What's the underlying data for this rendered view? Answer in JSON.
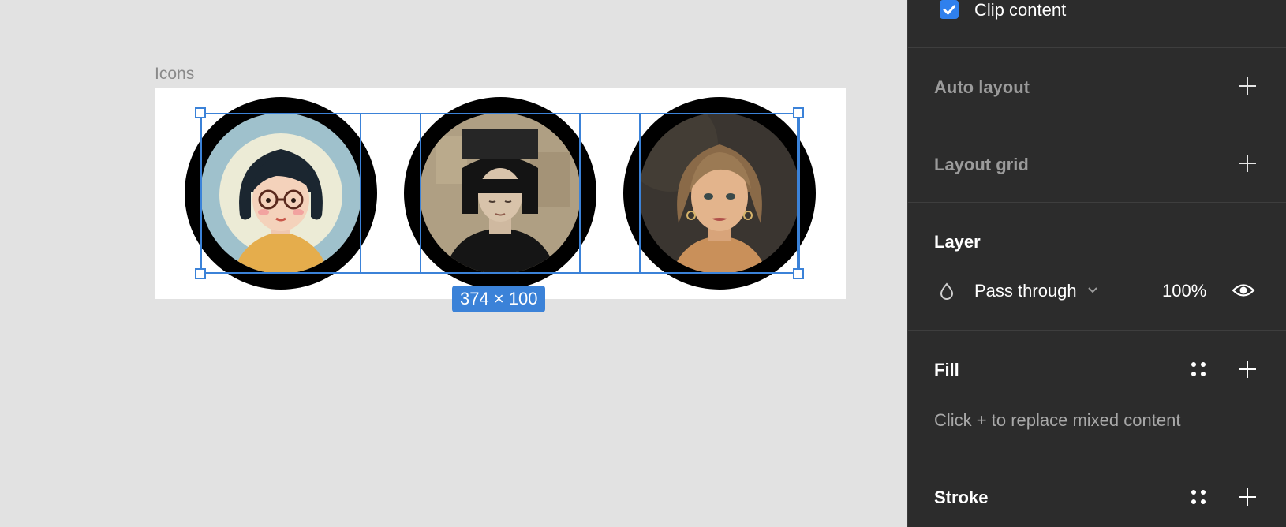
{
  "canvas": {
    "frame_label": "Icons",
    "size_badge": "374 × 100"
  },
  "panel": {
    "clip_content": {
      "label": "Clip content",
      "checked": true
    },
    "auto_layout": {
      "title": "Auto layout"
    },
    "layout_grid": {
      "title": "Layout grid"
    },
    "layer": {
      "title": "Layer",
      "blend_mode": "Pass through",
      "opacity": "100%"
    },
    "fill": {
      "title": "Fill",
      "message": "Click + to replace mixed content"
    },
    "stroke": {
      "title": "Stroke"
    }
  },
  "colors": {
    "selection": "#3b82d8",
    "checkbox": "#2f80ed",
    "panel_bg": "#2c2c2c",
    "canvas_bg": "#e2e2e2"
  }
}
